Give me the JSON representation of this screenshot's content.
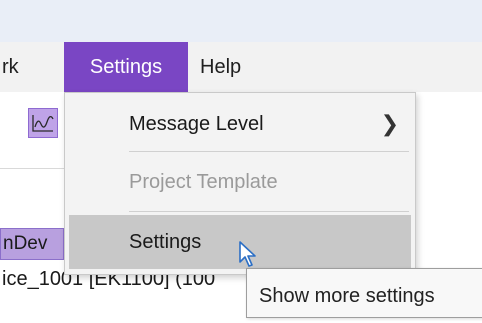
{
  "menubar": {
    "items": [
      {
        "label": "rk"
      },
      {
        "label": "Settings"
      },
      {
        "label": "Help"
      }
    ]
  },
  "toolbar": {
    "chart_button_icon": "chart-wave-icon"
  },
  "tree": {
    "device_chip_label": "nDev",
    "row_label": "ice_1001 [EK1100] (100"
  },
  "settings_menu": {
    "items": [
      {
        "label": "Message Level",
        "submenu_icon": "chevron-right-icon",
        "enabled": true
      },
      {
        "label": "Project Template",
        "enabled": false
      },
      {
        "label": "Settings",
        "enabled": true,
        "highlighted": true
      }
    ]
  },
  "tooltip": {
    "text": "Show more settings"
  },
  "colors": {
    "accent_purple": "#7a46c4",
    "highlight_gray": "#c8c8c8",
    "menu_bg": "#f3f3f3"
  }
}
